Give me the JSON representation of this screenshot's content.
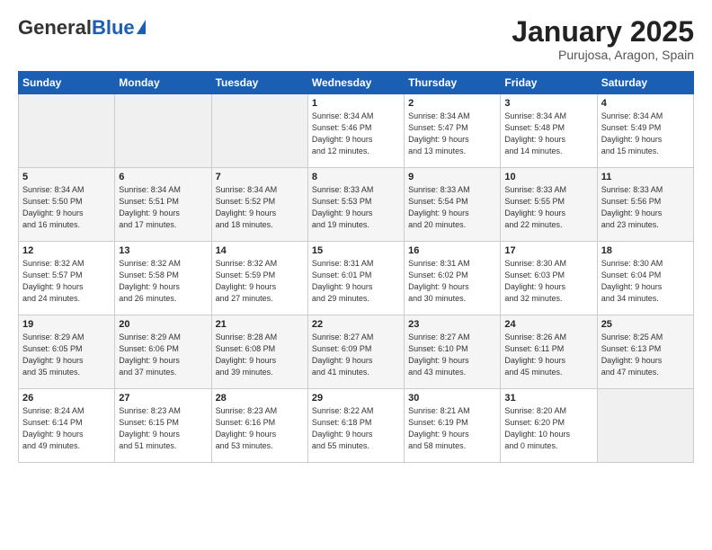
{
  "logo": {
    "general": "General",
    "blue": "Blue"
  },
  "header": {
    "month": "January 2025",
    "location": "Purujosa, Aragon, Spain"
  },
  "weekdays": [
    "Sunday",
    "Monday",
    "Tuesday",
    "Wednesday",
    "Thursday",
    "Friday",
    "Saturday"
  ],
  "weeks": [
    [
      {
        "day": "",
        "info": ""
      },
      {
        "day": "",
        "info": ""
      },
      {
        "day": "",
        "info": ""
      },
      {
        "day": "1",
        "info": "Sunrise: 8:34 AM\nSunset: 5:46 PM\nDaylight: 9 hours\nand 12 minutes."
      },
      {
        "day": "2",
        "info": "Sunrise: 8:34 AM\nSunset: 5:47 PM\nDaylight: 9 hours\nand 13 minutes."
      },
      {
        "day": "3",
        "info": "Sunrise: 8:34 AM\nSunset: 5:48 PM\nDaylight: 9 hours\nand 14 minutes."
      },
      {
        "day": "4",
        "info": "Sunrise: 8:34 AM\nSunset: 5:49 PM\nDaylight: 9 hours\nand 15 minutes."
      }
    ],
    [
      {
        "day": "5",
        "info": "Sunrise: 8:34 AM\nSunset: 5:50 PM\nDaylight: 9 hours\nand 16 minutes."
      },
      {
        "day": "6",
        "info": "Sunrise: 8:34 AM\nSunset: 5:51 PM\nDaylight: 9 hours\nand 17 minutes."
      },
      {
        "day": "7",
        "info": "Sunrise: 8:34 AM\nSunset: 5:52 PM\nDaylight: 9 hours\nand 18 minutes."
      },
      {
        "day": "8",
        "info": "Sunrise: 8:33 AM\nSunset: 5:53 PM\nDaylight: 9 hours\nand 19 minutes."
      },
      {
        "day": "9",
        "info": "Sunrise: 8:33 AM\nSunset: 5:54 PM\nDaylight: 9 hours\nand 20 minutes."
      },
      {
        "day": "10",
        "info": "Sunrise: 8:33 AM\nSunset: 5:55 PM\nDaylight: 9 hours\nand 22 minutes."
      },
      {
        "day": "11",
        "info": "Sunrise: 8:33 AM\nSunset: 5:56 PM\nDaylight: 9 hours\nand 23 minutes."
      }
    ],
    [
      {
        "day": "12",
        "info": "Sunrise: 8:32 AM\nSunset: 5:57 PM\nDaylight: 9 hours\nand 24 minutes."
      },
      {
        "day": "13",
        "info": "Sunrise: 8:32 AM\nSunset: 5:58 PM\nDaylight: 9 hours\nand 26 minutes."
      },
      {
        "day": "14",
        "info": "Sunrise: 8:32 AM\nSunset: 5:59 PM\nDaylight: 9 hours\nand 27 minutes."
      },
      {
        "day": "15",
        "info": "Sunrise: 8:31 AM\nSunset: 6:01 PM\nDaylight: 9 hours\nand 29 minutes."
      },
      {
        "day": "16",
        "info": "Sunrise: 8:31 AM\nSunset: 6:02 PM\nDaylight: 9 hours\nand 30 minutes."
      },
      {
        "day": "17",
        "info": "Sunrise: 8:30 AM\nSunset: 6:03 PM\nDaylight: 9 hours\nand 32 minutes."
      },
      {
        "day": "18",
        "info": "Sunrise: 8:30 AM\nSunset: 6:04 PM\nDaylight: 9 hours\nand 34 minutes."
      }
    ],
    [
      {
        "day": "19",
        "info": "Sunrise: 8:29 AM\nSunset: 6:05 PM\nDaylight: 9 hours\nand 35 minutes."
      },
      {
        "day": "20",
        "info": "Sunrise: 8:29 AM\nSunset: 6:06 PM\nDaylight: 9 hours\nand 37 minutes."
      },
      {
        "day": "21",
        "info": "Sunrise: 8:28 AM\nSunset: 6:08 PM\nDaylight: 9 hours\nand 39 minutes."
      },
      {
        "day": "22",
        "info": "Sunrise: 8:27 AM\nSunset: 6:09 PM\nDaylight: 9 hours\nand 41 minutes."
      },
      {
        "day": "23",
        "info": "Sunrise: 8:27 AM\nSunset: 6:10 PM\nDaylight: 9 hours\nand 43 minutes."
      },
      {
        "day": "24",
        "info": "Sunrise: 8:26 AM\nSunset: 6:11 PM\nDaylight: 9 hours\nand 45 minutes."
      },
      {
        "day": "25",
        "info": "Sunrise: 8:25 AM\nSunset: 6:13 PM\nDaylight: 9 hours\nand 47 minutes."
      }
    ],
    [
      {
        "day": "26",
        "info": "Sunrise: 8:24 AM\nSunset: 6:14 PM\nDaylight: 9 hours\nand 49 minutes."
      },
      {
        "day": "27",
        "info": "Sunrise: 8:23 AM\nSunset: 6:15 PM\nDaylight: 9 hours\nand 51 minutes."
      },
      {
        "day": "28",
        "info": "Sunrise: 8:23 AM\nSunset: 6:16 PM\nDaylight: 9 hours\nand 53 minutes."
      },
      {
        "day": "29",
        "info": "Sunrise: 8:22 AM\nSunset: 6:18 PM\nDaylight: 9 hours\nand 55 minutes."
      },
      {
        "day": "30",
        "info": "Sunrise: 8:21 AM\nSunset: 6:19 PM\nDaylight: 9 hours\nand 58 minutes."
      },
      {
        "day": "31",
        "info": "Sunrise: 8:20 AM\nSunset: 6:20 PM\nDaylight: 10 hours\nand 0 minutes."
      },
      {
        "day": "",
        "info": ""
      }
    ]
  ]
}
